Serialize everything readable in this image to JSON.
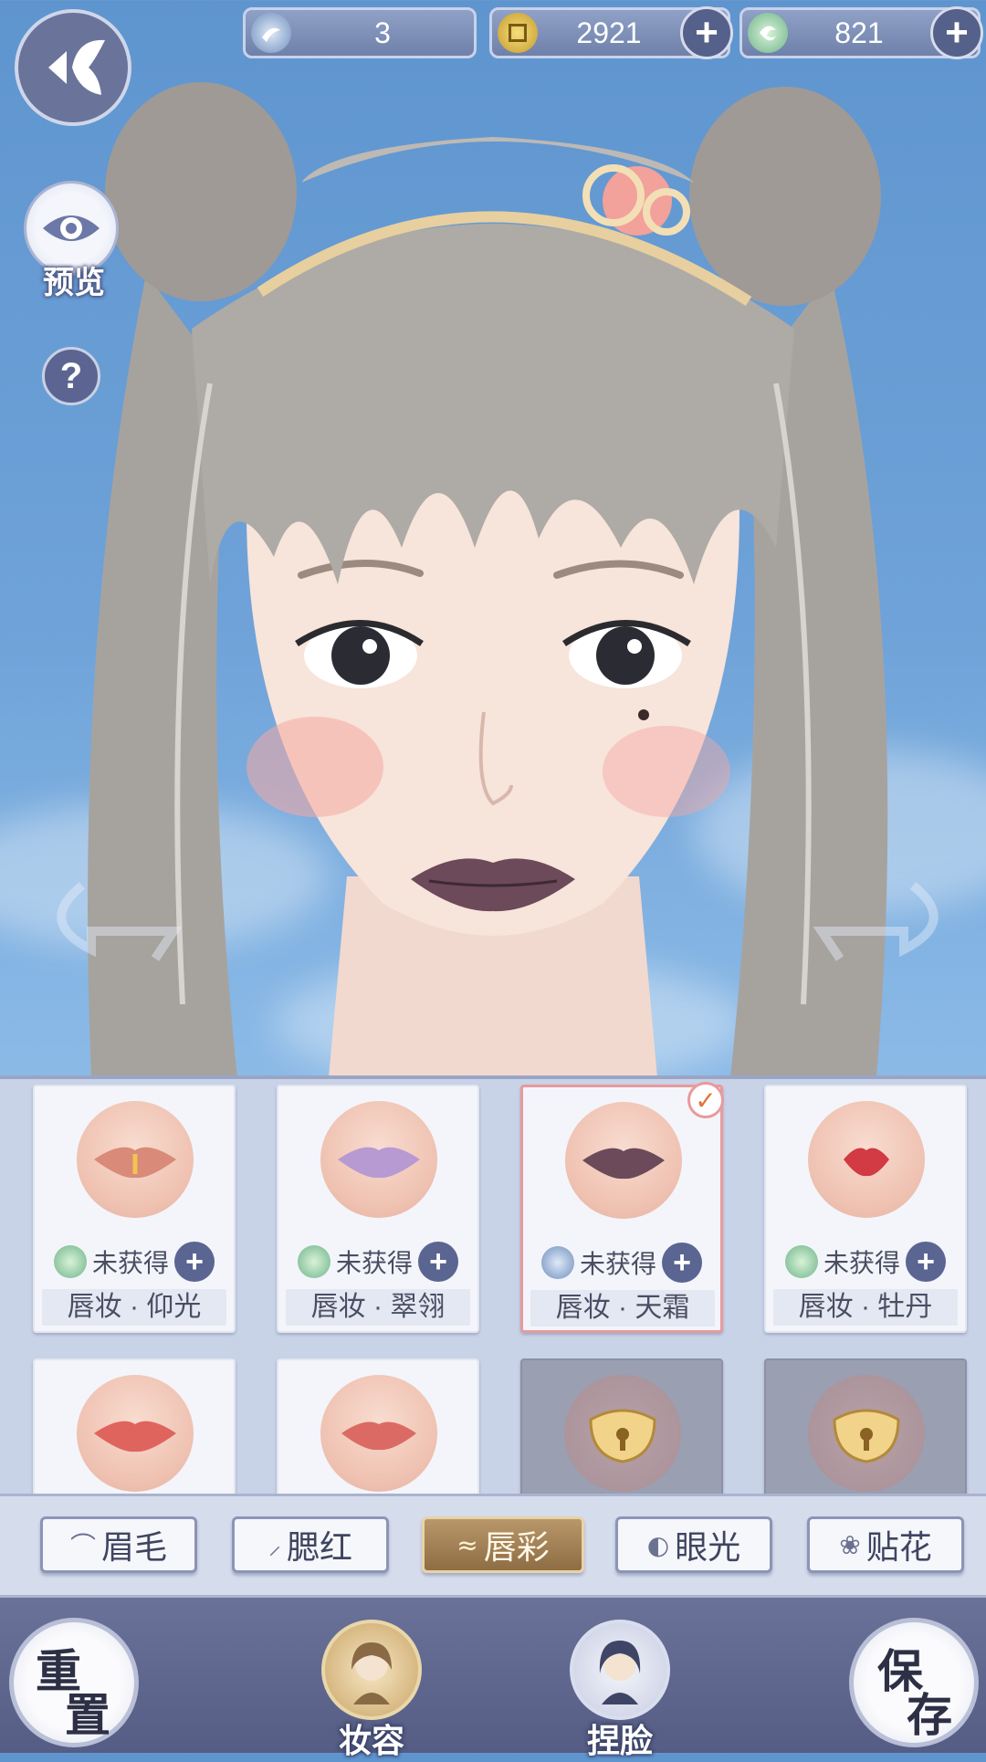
{
  "currencies": [
    {
      "name": "jade-coin",
      "value": "3",
      "has_plus": false
    },
    {
      "name": "copper-coin",
      "value": "2921",
      "has_plus": true
    },
    {
      "name": "dragon-jade",
      "value": "821",
      "has_plus": true
    }
  ],
  "side_buttons": {
    "preview_label": "预览",
    "help_label": "?"
  },
  "items": [
    {
      "status": "未获得",
      "name": "唇妆 · 仰光",
      "currency_icon": "dragon-jade-icon",
      "lip_color": "#d98a78",
      "selected": false,
      "locked": false
    },
    {
      "status": "未获得",
      "name": "唇妆 · 翠翎",
      "currency_icon": "dragon-jade-icon",
      "lip_color": "#b89ad2",
      "selected": false,
      "locked": false
    },
    {
      "status": "未获得",
      "name": "唇妆 · 天霜",
      "currency_icon": "jade-coin-icon",
      "lip_color": "#6c4a5a",
      "selected": true,
      "locked": false
    },
    {
      "status": "未获得",
      "name": "唇妆 · 牡丹",
      "currency_icon": "dragon-jade-icon",
      "lip_color": "#d23a44",
      "selected": false,
      "locked": false
    },
    {
      "lip_color": "#e0645e",
      "selected": false,
      "locked": false
    },
    {
      "lip_color": "#dc6a64",
      "selected": false,
      "locked": false
    },
    {
      "locked": true
    },
    {
      "locked": true
    }
  ],
  "tabs": [
    {
      "label": "眉毛",
      "icon": "brow-icon",
      "active": false
    },
    {
      "label": "腮红",
      "icon": "blush-icon",
      "active": false
    },
    {
      "label": "唇彩",
      "icon": "lips-icon",
      "active": true
    },
    {
      "label": "眼光",
      "icon": "eye-highlight-icon",
      "active": false
    },
    {
      "label": "贴花",
      "icon": "flower-icon",
      "active": false
    }
  ],
  "bottom": {
    "reset_chars": [
      "重",
      "置"
    ],
    "save_chars": [
      "保",
      "存"
    ],
    "makeup_label": "妆容",
    "face_label": "捏脸"
  },
  "colors": {
    "accent_gold": "#b8976a",
    "panel_bg": "#c9d3e8",
    "bar_bg": "#6a7299",
    "selected_border": "#e89a9c"
  }
}
